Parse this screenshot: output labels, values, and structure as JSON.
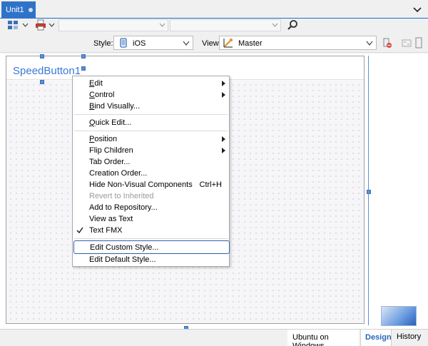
{
  "tab": {
    "label": "Unit1"
  },
  "toolbar": {
    "style_label": "Style:",
    "style_value": "iOS",
    "view_label": "View:",
    "view_value": "Master"
  },
  "designer": {
    "component_label": "SpeedButton1"
  },
  "context_menu": {
    "items": [
      {
        "label": "Edit",
        "underline": "E",
        "submenu": true
      },
      {
        "label": "Control",
        "underline": "C",
        "submenu": true
      },
      {
        "label": "Bind Visually...",
        "underline": "B"
      },
      {
        "label": "Quick Edit...",
        "underline": "Q"
      },
      {
        "label": "Position",
        "underline": "P",
        "submenu": true
      },
      {
        "label": "Flip Children",
        "submenu": true
      },
      {
        "label": "Tab Order..."
      },
      {
        "label": "Creation Order..."
      },
      {
        "label": "Hide Non-Visual Components",
        "shortcut": "Ctrl+H"
      },
      {
        "label": "Revert to Inherited",
        "disabled": true
      },
      {
        "label": "Add to Repository..."
      },
      {
        "label": "View as Text"
      },
      {
        "label": "Text FMX",
        "checked": true
      },
      {
        "label": "Edit Custom Style...",
        "focused": true
      },
      {
        "label": "Edit Default Style..."
      }
    ]
  },
  "statusbar": {
    "platform": "Ubuntu on Windows",
    "design": "Design",
    "history": "History"
  },
  "colors": {
    "accent": "#2f73c8",
    "selection_handle": "#5b8fd6",
    "component_text": "#3c78d8"
  }
}
